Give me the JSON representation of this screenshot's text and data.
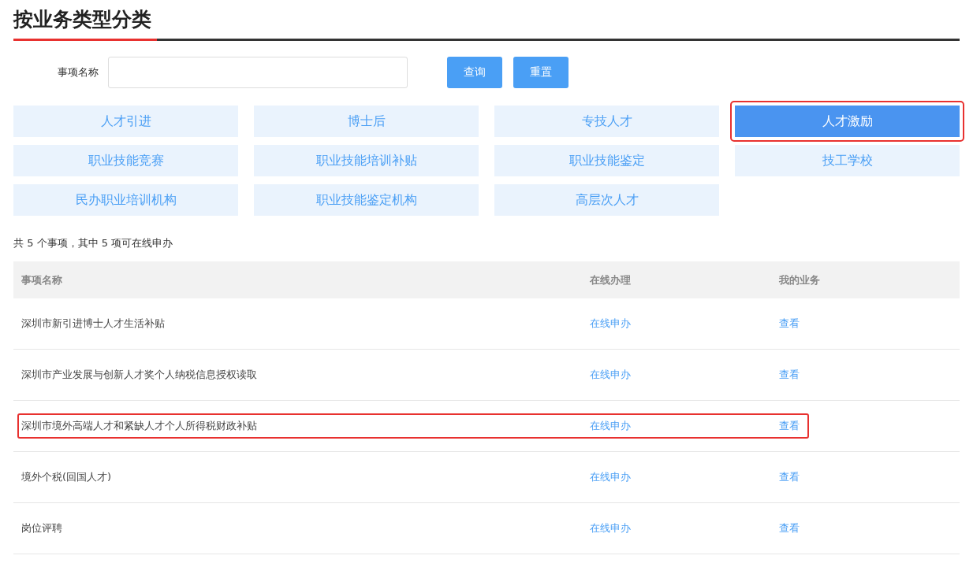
{
  "title": "按业务类型分类",
  "search": {
    "label": "事项名称",
    "buttons": [
      "查询",
      "重置"
    ]
  },
  "categories": [
    {
      "label": "人才引进",
      "selected": false,
      "highlighted": false
    },
    {
      "label": "博士后",
      "selected": false,
      "highlighted": false
    },
    {
      "label": "专技人才",
      "selected": false,
      "highlighted": false
    },
    {
      "label": "人才激励",
      "selected": true,
      "highlighted": true
    },
    {
      "label": "职业技能竞赛",
      "selected": false,
      "highlighted": false
    },
    {
      "label": "职业技能培训补贴",
      "selected": false,
      "highlighted": false
    },
    {
      "label": "职业技能鉴定",
      "selected": false,
      "highlighted": false
    },
    {
      "label": "技工学校",
      "selected": false,
      "highlighted": false
    },
    {
      "label": "民办职业培训机构",
      "selected": false,
      "highlighted": false
    },
    {
      "label": "职业技能鉴定机构",
      "selected": false,
      "highlighted": false
    },
    {
      "label": "高层次人才",
      "selected": false,
      "highlighted": false
    }
  ],
  "summary": "共 5 个事项，其中 5 项可在线申办",
  "table": {
    "columns": [
      "事项名称",
      "在线办理",
      "我的业务"
    ],
    "rows": [
      {
        "name": "深圳市新引进博士人才生活补贴",
        "online": "在线申办",
        "mine": "查看",
        "highlighted": false
      },
      {
        "name": "深圳市产业发展与创新人才奖个人纳税信息授权读取",
        "online": "在线申办",
        "mine": "查看",
        "highlighted": false
      },
      {
        "name": "深圳市境外高端人才和紧缺人才个人所得税财政补贴",
        "online": "在线申办",
        "mine": "查看",
        "highlighted": true
      },
      {
        "name": "境外个税(回国人才)",
        "online": "在线申办",
        "mine": "查看",
        "highlighted": false
      },
      {
        "name": "岗位评聘",
        "online": "在线申办",
        "mine": "查看",
        "highlighted": false
      }
    ]
  }
}
